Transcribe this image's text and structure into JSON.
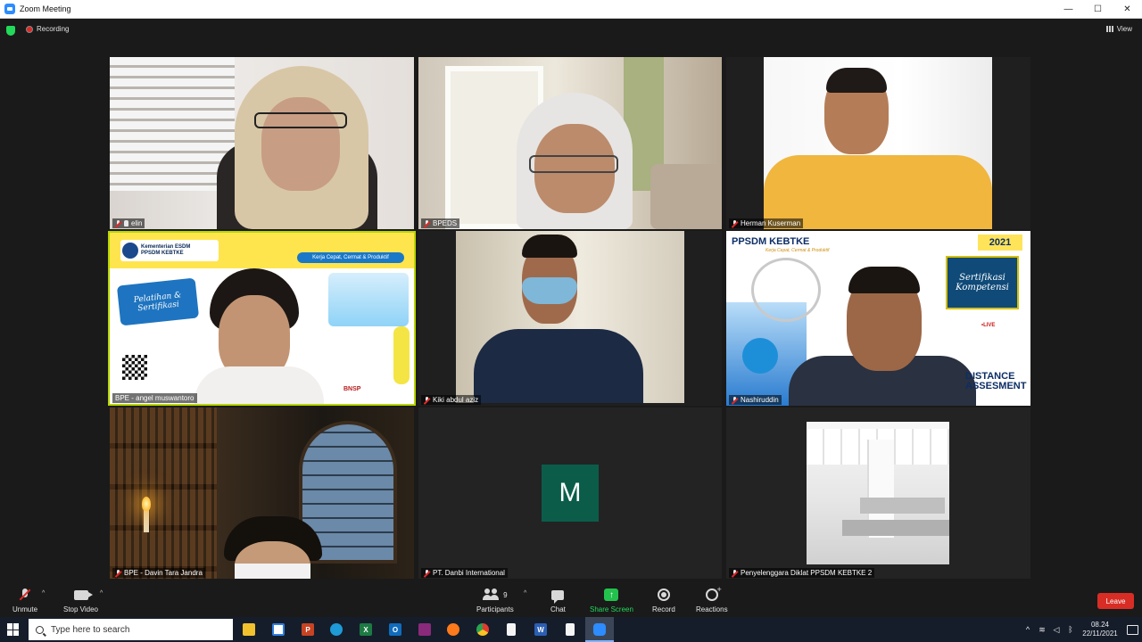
{
  "window": {
    "title": "Zoom Meeting",
    "minimize": "—",
    "maximize": "☐",
    "close": "✕"
  },
  "meeting_bar": {
    "recording_label": "Recording",
    "view_label": "View"
  },
  "tiles": [
    {
      "name": "elin",
      "muted": true,
      "hand": true
    },
    {
      "name": "BPEDS",
      "muted": true
    },
    {
      "name": "Herman Kuserman",
      "muted": true
    },
    {
      "name": "BPE - angel muswantoro",
      "muted": false,
      "active_speaker": true
    },
    {
      "name": "Kiki abdul aziz",
      "muted": true
    },
    {
      "name": "Nashiruddin",
      "muted": true
    },
    {
      "name": "BPE - Davin Tara Jandra",
      "muted": true
    },
    {
      "name": "PT. Danbi International",
      "muted": true,
      "avatar_letter": "M",
      "avatar_color": "#0b5d4a"
    },
    {
      "name": "Penyelenggara Diklat PPSDM KEBTKE 2",
      "muted": true
    }
  ],
  "slide_t4": {
    "org_line1": "Kementerian ESDM",
    "org_line2": "PPSDM KEBTKE",
    "tagline": "Kerja Cepat, Cermat & Produktif",
    "badge": "Pelatihan & Sertifikasi",
    "bnsp": "BNSP"
  },
  "slide_t6": {
    "header": "PPSDM KEBTKE",
    "subheader": "Kerja Cepat, Cermat & Produktif",
    "year": "2021",
    "banner": "Sertifikasi Kompetensi",
    "live": "•LIVE",
    "distance_line1": "DISTANCE",
    "distance_line2": "ASSESMENT"
  },
  "toolbar": {
    "unmute": "Unmute",
    "stop_video": "Stop Video",
    "participants": "Participants",
    "participant_count": "9",
    "chat": "Chat",
    "share_screen": "Share Screen",
    "record": "Record",
    "reactions": "Reactions",
    "leave": "Leave",
    "caret": "^"
  },
  "taskbar": {
    "search_placeholder": "Type here to search",
    "time": "08.24",
    "date": "22/11/2021",
    "apps": [
      "file-explorer",
      "store",
      "powerpoint",
      "edge",
      "excel",
      "outlook",
      "winrar",
      "firefox",
      "chrome",
      "file",
      "word",
      "file",
      "zoom"
    ]
  },
  "colors": {
    "accent_green": "#23d959",
    "leave_red": "#d82d25",
    "active_border": "#b8d600"
  }
}
